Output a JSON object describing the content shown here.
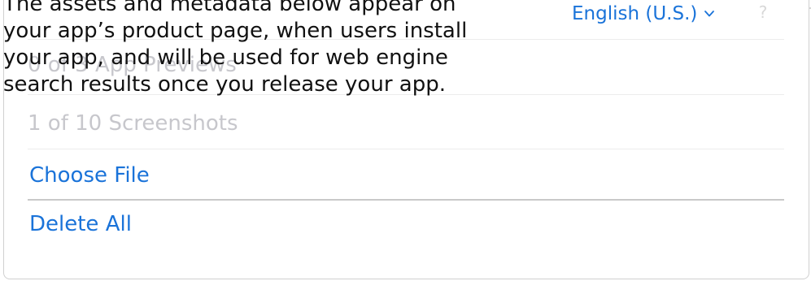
{
  "header": {
    "language_label": "English (U.S.)",
    "help_glyph": "?"
  },
  "media": {
    "previews_label": "0 of 3 App Previews",
    "screenshots_label": "1 of 10 Screenshots"
  },
  "menu": {
    "choose_file_label": "Choose File",
    "delete_all_label": "Delete All"
  },
  "tooltip": {
    "lines": [
      "The assets and metadata below appear on",
      "your app’s product page, when users install",
      "your app, and will be used for web engine",
      "search results once you release your app."
    ]
  },
  "colors": {
    "link": "#1a73d9",
    "muted_text": "#c7c7cc",
    "tooltip_text": "#111111"
  },
  "icons": {
    "language_dropdown": "chevron-down-icon",
    "help": "question-mark-icon"
  }
}
